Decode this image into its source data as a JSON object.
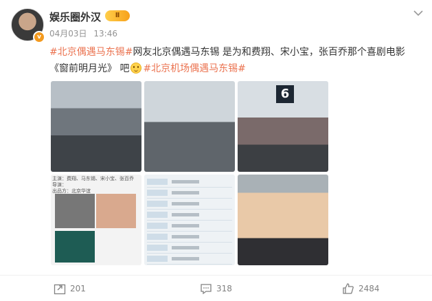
{
  "header": {
    "username": "娱乐圈外汉",
    "user_badge": "Ⅱ",
    "verified_badge": "v",
    "date": "04月03日",
    "time": "13:46"
  },
  "post": {
    "tag1": "#北京偶遇马东锡#",
    "text1": "网友北京偶遇马东锡 是为和费翔、宋小宝，张百乔那个喜剧电影《窗前明月光》 吧",
    "tag2": "#北京机场偶遇马东锡#"
  },
  "photo_texts": {
    "gate_number": "6",
    "poster_lines": [
      "主演：费翔、马东锡、宋小宝、张百乔",
      "导演：",
      "出品方：北京华谊"
    ]
  },
  "actions": {
    "repost_count": "201",
    "comment_count": "318",
    "like_count": "2484"
  },
  "icons": {
    "repost": "repost-icon",
    "comment": "comment-icon",
    "like": "like-icon",
    "menu": "chevron-down-icon"
  }
}
